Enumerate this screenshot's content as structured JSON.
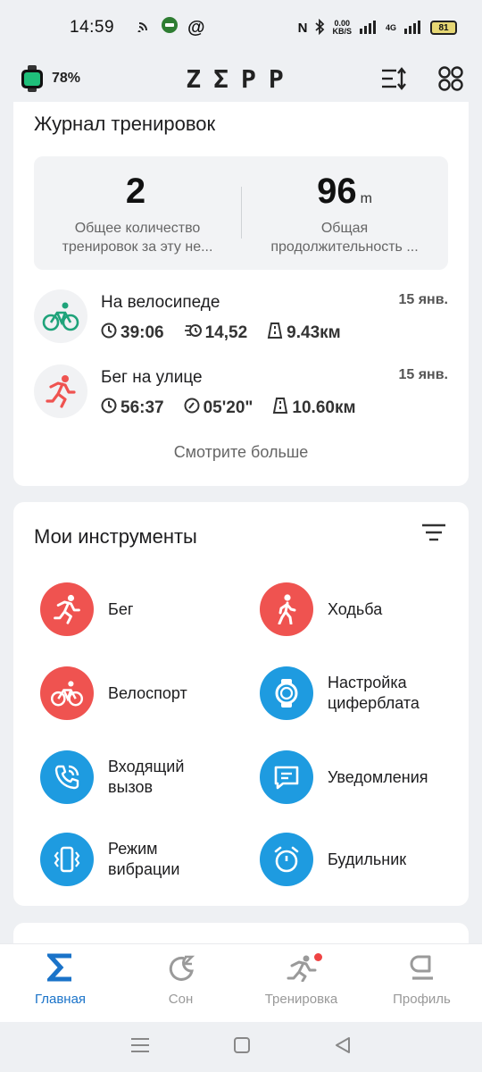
{
  "status_bar": {
    "time": "14:59",
    "speed_top": "0.00",
    "speed_bottom": "KB/S",
    "network": "4G",
    "battery": "81"
  },
  "app_bar": {
    "watch_battery": "78%",
    "logo": "ZΣPP",
    "sort_icon": "sort-icon",
    "apps_icon": "apps-grid-icon"
  },
  "journal": {
    "title": "Журнал тренировок",
    "summary": [
      {
        "value": "2",
        "unit": "",
        "label": "Общее количество тренировок за эту не..."
      },
      {
        "value": "96",
        "unit": "m",
        "label": "Общая продолжительность ..."
      }
    ],
    "workouts": [
      {
        "name": "На велосипеде",
        "date": "15 янв.",
        "icon": "bike-icon",
        "duration": "39:06",
        "pace": "14,52",
        "distance": "9.43км"
      },
      {
        "name": "Бег на улице",
        "date": "15 янв.",
        "icon": "run-icon",
        "duration": "56:37",
        "pace": "05'20\"",
        "distance": "10.60км"
      }
    ],
    "see_more": "Смотрите больше"
  },
  "tools": {
    "title": "Мои инструменты",
    "items": [
      {
        "label": "Бег",
        "icon": "run-icon",
        "color": "#ef5350"
      },
      {
        "label": "Ходьба",
        "icon": "walk-icon",
        "color": "#ef5350"
      },
      {
        "label": "Велоспорт",
        "icon": "bike-icon",
        "color": "#ef5350"
      },
      {
        "label": "Настройка циферблата",
        "icon": "watch-face-icon",
        "color": "#1e9be0"
      },
      {
        "label": "Входящий вызов",
        "icon": "phone-call-icon",
        "color": "#1e9be0"
      },
      {
        "label": "Уведомления",
        "icon": "message-icon",
        "color": "#1e9be0"
      },
      {
        "label": "Режим вибрации",
        "icon": "vibration-icon",
        "color": "#1e9be0"
      },
      {
        "label": "Будильник",
        "icon": "alarm-icon",
        "color": "#1e9be0"
      }
    ]
  },
  "bottom_nav": {
    "items": [
      {
        "label": "Главная",
        "icon": "sigma-icon",
        "active": true
      },
      {
        "label": "Сон",
        "icon": "sleep-icon",
        "active": false
      },
      {
        "label": "Тренировка",
        "icon": "workout-icon",
        "active": false
      },
      {
        "label": "Профиль",
        "icon": "profile-icon",
        "active": false
      }
    ]
  },
  "colors": {
    "accent": "#1a73c9",
    "activity_red": "#ef5350",
    "tool_blue": "#1e9be0",
    "bike_green": "#1fa37a"
  }
}
